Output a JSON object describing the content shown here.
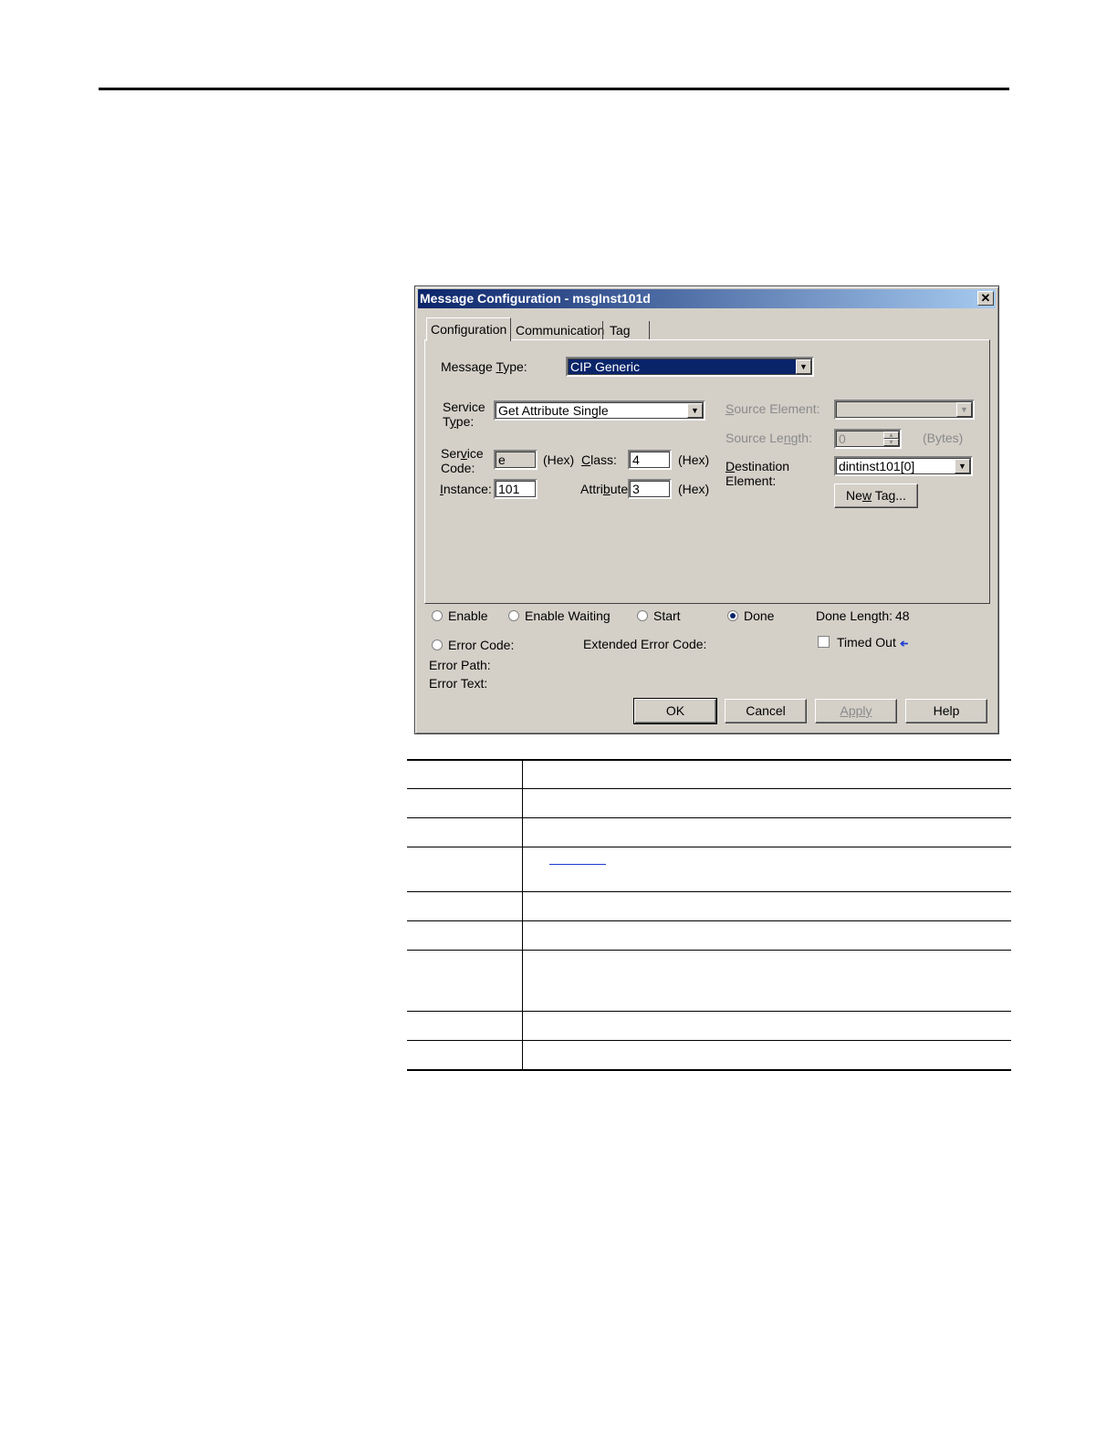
{
  "dialog": {
    "title": "Message Configuration - msgInst101d",
    "close_glyph": "✕",
    "tabs": [
      "Configuration",
      "Communication",
      "Tag"
    ],
    "message_type": {
      "label_pre": "Message ",
      "label_u": "T",
      "label_post": "ype:",
      "value": "CIP Generic"
    },
    "service_type": {
      "label1": "Service",
      "label2_pre": "T",
      "label2_u": "y",
      "label2_post": "pe:",
      "value": "Get Attribute Single"
    },
    "service_code": {
      "label1_pre": "Ser",
      "label1_u": "v",
      "label1_post": "ice",
      "label2": "Code:",
      "value": "e",
      "unit": "(Hex)"
    },
    "class": {
      "label_u": "C",
      "label_post": "lass:",
      "value": "4",
      "unit": "(Hex)"
    },
    "instance": {
      "label_u": "I",
      "label_post": "nstance:",
      "value": "101"
    },
    "attribute": {
      "label_pre": "Attri",
      "label_u": "b",
      "label_post": "ute:",
      "value": "3",
      "unit": "(Hex)"
    },
    "source_element": {
      "label_u": "S",
      "label_post": "ource Element:",
      "value": ""
    },
    "source_length": {
      "label_pre": "Source Le",
      "label_u": "n",
      "label_post": "gth:",
      "value": "0",
      "unit": "(Bytes)"
    },
    "destination_element": {
      "label1_u": "D",
      "label1_post": "estination",
      "label2": "Element:",
      "value": "dintinst101[0]"
    },
    "new_tag_button": {
      "label_pre": "Ne",
      "label_u": "w",
      "label_post": " Tag..."
    },
    "status": {
      "enable": "Enable",
      "enable_waiting": "Enable Waiting",
      "start": "Start",
      "done": "Done",
      "done_length_label": "Done Length:",
      "done_length_value": "48",
      "error_code": "Error Code:",
      "extended_error_code": "Extended Error Code:",
      "timed_out": "Timed Out",
      "timed_out_arrow": "➔",
      "error_path": "Error Path:",
      "error_text": "Error Text:"
    },
    "buttons": {
      "ok": "OK",
      "cancel": "Cancel",
      "apply": "Apply",
      "help": "Help"
    },
    "spinner_up": "▴",
    "spinner_down": "▾",
    "dropdown_glyph": "▼"
  }
}
